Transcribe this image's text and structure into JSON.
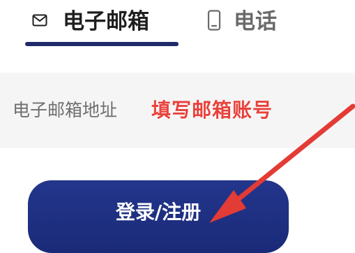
{
  "tabs": {
    "email": {
      "label": "电子邮箱",
      "icon": "envelope-icon",
      "active": true
    },
    "phone": {
      "label": "电话",
      "icon": "phone-icon",
      "active": false
    }
  },
  "email_field": {
    "placeholder": "电子邮箱地址"
  },
  "annotation": {
    "text": "填写邮箱账号",
    "color": "#e8423c",
    "icon": "red-arrow-icon"
  },
  "login_button": {
    "label": "登录/注册",
    "color": "#1f2f7e"
  },
  "colors": {
    "accent": "#1e2a6b",
    "annotation": "#e8423c"
  }
}
